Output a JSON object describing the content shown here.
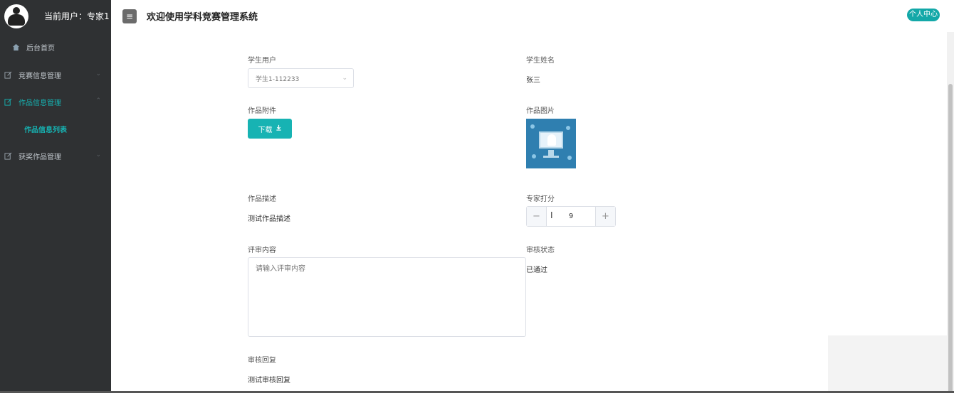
{
  "sidebar": {
    "user_label": "当前用户：专家1",
    "items": [
      {
        "label": "后台首页"
      },
      {
        "label": "竞赛信息管理"
      },
      {
        "label": "作品信息管理"
      },
      {
        "label": "作品信息列表"
      },
      {
        "label": "获奖作品管理"
      }
    ]
  },
  "header": {
    "menu_icon": "≡",
    "title": "欢迎使用学科竞赛管理系统",
    "profile_button": "个人中心"
  },
  "form": {
    "student_user_label": "学生用户",
    "student_user_value": "学生1-112233",
    "student_name_label": "学生姓名",
    "student_name_value": "张三",
    "attachment_label": "作品附件",
    "download_button": "下载",
    "image_label": "作品图片",
    "description_label": "作品描述",
    "description_value": "测试作品描述",
    "score_label": "专家打分",
    "score_value": "9",
    "review_content_label": "评审内容",
    "review_content_placeholder": "请输入评审内容",
    "audit_status_label": "审核状态",
    "audit_status_value": "已通过",
    "audit_reply_label": "审核回复",
    "audit_reply_value": "测试审核回复"
  },
  "colors": {
    "accent": "#17b3b3",
    "sidebar_bg": "#2f3133"
  }
}
